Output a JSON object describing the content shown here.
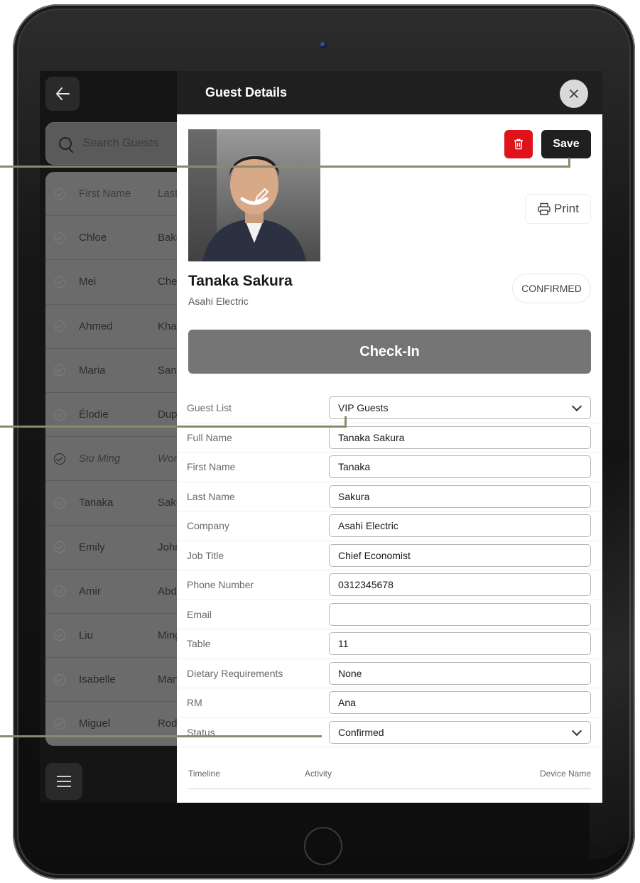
{
  "header": {
    "title": "Guest Details"
  },
  "search": {
    "placeholder": "Search Guests"
  },
  "guest_list": {
    "columns": [
      "First Name",
      "Last Name"
    ],
    "rows": [
      {
        "first": "Chloe",
        "last": "Baker"
      },
      {
        "first": "Mei",
        "last": "Chen"
      },
      {
        "first": "Ahmed",
        "last": "Khan"
      },
      {
        "first": "Maria",
        "last": "Santos"
      },
      {
        "first": "Élodie",
        "last": "Dupont"
      },
      {
        "first": "Siu Ming",
        "last": "Wong"
      },
      {
        "first": "Tanaka",
        "last": "Sakura"
      },
      {
        "first": "Emily",
        "last": "Johnson"
      },
      {
        "first": "Amir",
        "last": "Abdullah"
      },
      {
        "first": "Liu",
        "last": "Ming"
      },
      {
        "first": "Isabelle",
        "last": "Martin"
      },
      {
        "first": "Miguel",
        "last": "Rodriguez"
      }
    ]
  },
  "toolbar": {
    "save_label": "Save",
    "print_label": "Print"
  },
  "guest": {
    "name": "Tanaka Sakura",
    "company": "Asahi Electric",
    "status_badge": "CONFIRMED"
  },
  "checkin": {
    "label": "Check-In"
  },
  "form": {
    "guest_list": {
      "label": "Guest List",
      "value": "VIP Guests"
    },
    "full_name": {
      "label": "Full Name",
      "value": "Tanaka Sakura"
    },
    "first_name": {
      "label": "First Name",
      "value": "Tanaka"
    },
    "last_name": {
      "label": "Last Name",
      "value": "Sakura"
    },
    "company": {
      "label": "Company",
      "value": "Asahi Electric"
    },
    "job_title": {
      "label": "Job Title",
      "value": "Chief Economist"
    },
    "phone": {
      "label": "Phone Number",
      "value": "0312345678"
    },
    "email": {
      "label": "Email",
      "value": ""
    },
    "table": {
      "label": "Table",
      "value": "11"
    },
    "dietary": {
      "label": "Dietary Requirements",
      "value": "None"
    },
    "rm": {
      "label": "RM",
      "value": "Ana"
    },
    "status": {
      "label": "Status",
      "value": "Confirmed"
    }
  },
  "timeline": {
    "col1": "Timeline",
    "col2": "Activity",
    "col3": "Device Name"
  },
  "icons": {
    "back": "arrow-left-icon",
    "close": "close-icon",
    "trash": "trash-icon",
    "print": "printer-icon",
    "edit": "pencil-icon",
    "menu": "hamburger-icon",
    "search": "search-icon"
  },
  "colors": {
    "danger": "#e0131b",
    "dark": "#1f1f1f",
    "checkin": "#757575",
    "callout": "#8a8a6c"
  }
}
